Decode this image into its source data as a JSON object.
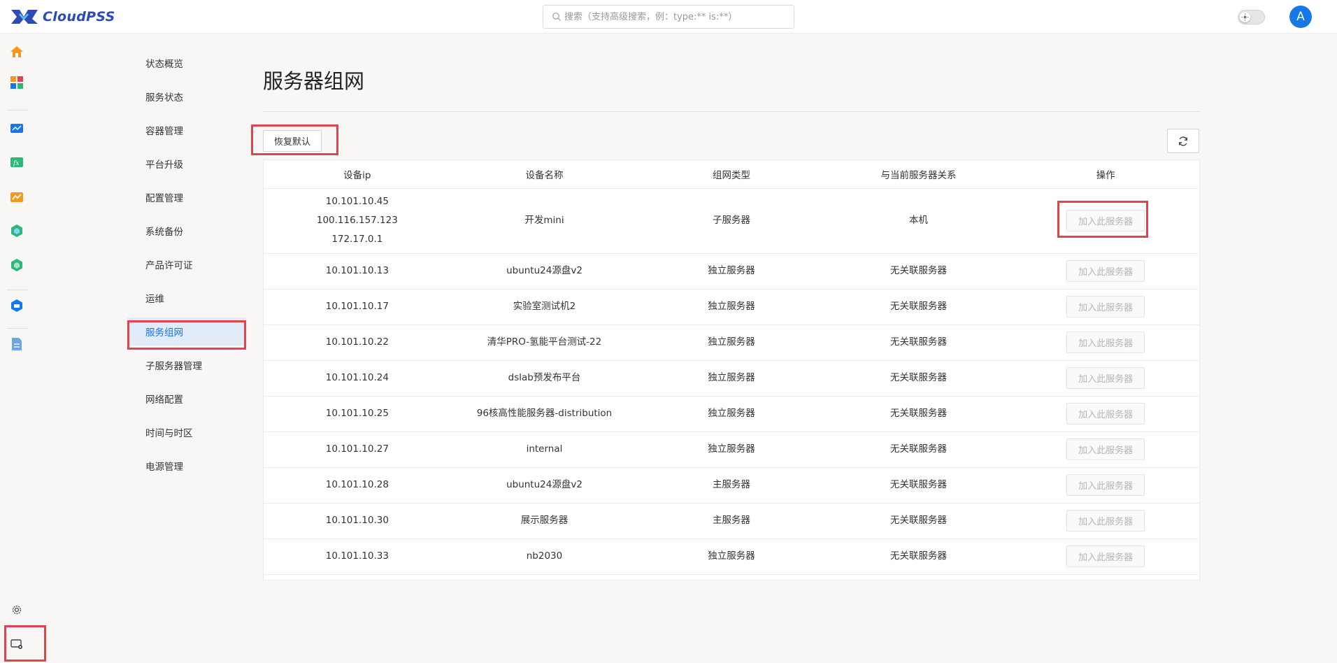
{
  "app": {
    "logo_text": "CloudPSS"
  },
  "search": {
    "placeholder": "搜索（支持高级搜索，例：type:** is:**）"
  },
  "user": {
    "avatar_letter": "A"
  },
  "subnav": {
    "items": [
      {
        "label": "状态概览"
      },
      {
        "label": "服务状态"
      },
      {
        "label": "容器管理"
      },
      {
        "label": "平台升级"
      },
      {
        "label": "配置管理"
      },
      {
        "label": "系统备份"
      },
      {
        "label": "产品许可证"
      },
      {
        "label": "运维"
      },
      {
        "label": "服务组网",
        "active": true
      },
      {
        "label": "子服务器管理"
      },
      {
        "label": "网络配置"
      },
      {
        "label": "时间与时区"
      },
      {
        "label": "电源管理"
      }
    ]
  },
  "main": {
    "title": "服务器组网",
    "restore_label": "恢复默认"
  },
  "table": {
    "headers": [
      "设备ip",
      "设备名称",
      "组网类型",
      "与当前服务器关系",
      "操作"
    ],
    "action_label": "加入此服务器",
    "rows": [
      {
        "ip_lines": [
          "10.101.10.45",
          "100.116.157.123",
          "172.17.0.1"
        ],
        "name": "开发mini",
        "type": "子服务器",
        "relation": "本机"
      },
      {
        "ip_lines": [
          "10.101.10.13"
        ],
        "name": "ubuntu24源盘v2",
        "type": "独立服务器",
        "relation": "无关联服务器"
      },
      {
        "ip_lines": [
          "10.101.10.17"
        ],
        "name": "实验室测试机2",
        "type": "独立服务器",
        "relation": "无关联服务器"
      },
      {
        "ip_lines": [
          "10.101.10.22"
        ],
        "name": "清华PRO-氢能平台测试-22",
        "type": "独立服务器",
        "relation": "无关联服务器"
      },
      {
        "ip_lines": [
          "10.101.10.24"
        ],
        "name": "dslab预发布平台",
        "type": "独立服务器",
        "relation": "无关联服务器"
      },
      {
        "ip_lines": [
          "10.101.10.25"
        ],
        "name": "96核高性能服务器-distribution",
        "type": "独立服务器",
        "relation": "无关联服务器"
      },
      {
        "ip_lines": [
          "10.101.10.27"
        ],
        "name": "internal",
        "type": "独立服务器",
        "relation": "无关联服务器"
      },
      {
        "ip_lines": [
          "10.101.10.28"
        ],
        "name": "ubuntu24源盘v2",
        "type": "主服务器",
        "relation": "无关联服务器"
      },
      {
        "ip_lines": [
          "10.101.10.30"
        ],
        "name": "展示服务器",
        "type": "主服务器",
        "relation": "无关联服务器"
      },
      {
        "ip_lines": [
          "10.101.10.33"
        ],
        "name": "nb2030",
        "type": "独立服务器",
        "relation": "无关联服务器"
      }
    ]
  },
  "colors": {
    "accent": "#1677e8",
    "highlight": "#e0454f",
    "brand": "#2c4bb6"
  }
}
